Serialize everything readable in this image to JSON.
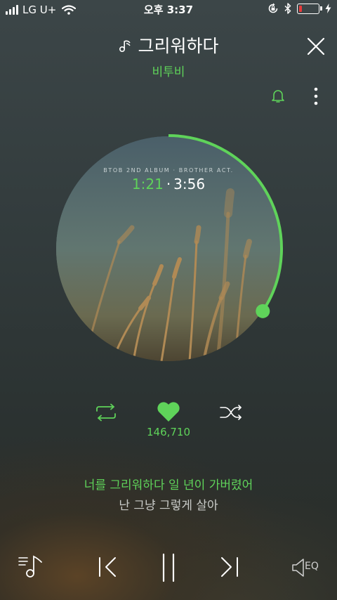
{
  "status_bar": {
    "carrier": "LG U+",
    "time": "오후 3:37",
    "battery_level": 0.18,
    "signal_bars": 4
  },
  "header": {
    "title": "그리워하다",
    "artist": "비투비"
  },
  "album": {
    "label": "BTOB 2ND ALBUM · BROTHER ACT.",
    "elapsed": "1:21",
    "separator": "·",
    "total": "3:56",
    "progress": 0.343
  },
  "actions": {
    "like_count": "146,710"
  },
  "lyrics": {
    "current": "너를 그리워하다 일 년이 가버렸어",
    "next": "난 그냥 그렇게 살아"
  },
  "player": {
    "eq_label": "EQ"
  },
  "colors": {
    "accent": "#5fd35a",
    "battery_low": "#e83a3a"
  },
  "icons": [
    "music-note-icon",
    "close-icon",
    "bell-icon",
    "more-icon",
    "repeat-icon",
    "heart-icon",
    "shuffle-icon",
    "playlist-icon",
    "previous-icon",
    "pause-icon",
    "next-icon",
    "speaker-eq-icon"
  ]
}
